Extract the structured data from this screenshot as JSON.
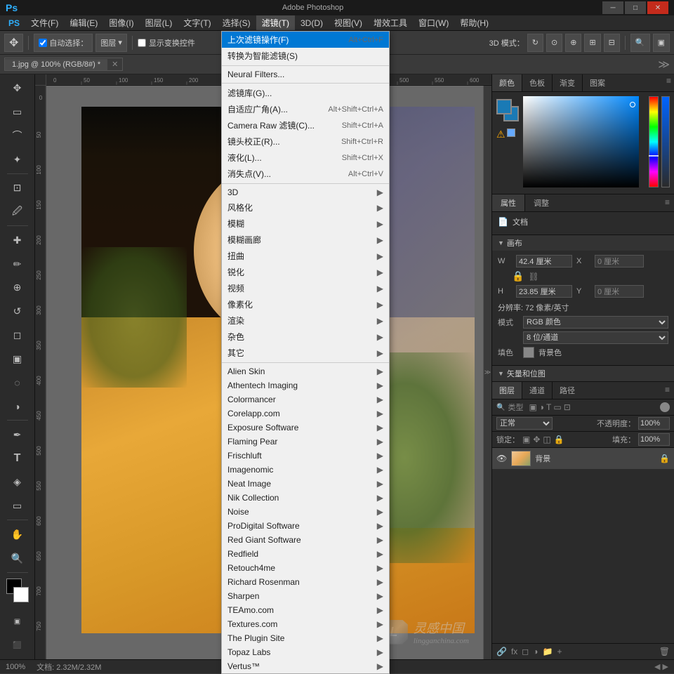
{
  "titleBar": {
    "title": "Adobe Photoshop",
    "fileInfo": "1.jpg @ 100% (RGB/8#) *",
    "controls": [
      "─",
      "□",
      "✕"
    ]
  },
  "menuBar": {
    "items": [
      "PS",
      "文件(F)",
      "编辑(E)",
      "图像(I)",
      "图层(L)",
      "文字(T)",
      "选择(S)",
      "滤镜(T)",
      "3D(D)",
      "视图(V)",
      "增效工具",
      "窗口(W)",
      "帮助(H)"
    ]
  },
  "filterMenu": {
    "active": "滤镜(T)",
    "topItems": [
      {
        "label": "上次滤镜操作(F)",
        "shortcut": "Alt+Ctrl+F",
        "hasArrow": false
      },
      {
        "label": "转换为智能滤镜(S)",
        "hasArrow": false
      }
    ],
    "midItems": [
      {
        "label": "Neural Filters...",
        "hasArrow": false
      }
    ],
    "filterItems": [
      {
        "label": "滤镜库(G)...",
        "hasArrow": false
      },
      {
        "label": "自适应广角(A)...",
        "shortcut": "Alt+Shift+Ctrl+A",
        "hasArrow": false
      },
      {
        "label": "Camera Raw 滤镜(C)...",
        "shortcut": "Shift+Ctrl+A",
        "hasArrow": false
      },
      {
        "label": "镜头校正(R)...",
        "shortcut": "Shift+Ctrl+R",
        "hasArrow": false
      },
      {
        "label": "液化(L)...",
        "shortcut": "Shift+Ctrl+X",
        "hasArrow": false
      },
      {
        "label": "消失点(V)...",
        "shortcut": "Alt+Ctrl+V",
        "hasArrow": false
      }
    ],
    "subMenuItems": [
      {
        "label": "3D",
        "hasArrow": true
      },
      {
        "label": "风格化",
        "hasArrow": true
      },
      {
        "label": "模糊",
        "hasArrow": true
      },
      {
        "label": "模糊画廊",
        "hasArrow": true
      },
      {
        "label": "扭曲",
        "hasArrow": true
      },
      {
        "label": "锐化",
        "hasArrow": true
      },
      {
        "label": "视频",
        "hasArrow": true
      },
      {
        "label": "像素化",
        "hasArrow": true
      },
      {
        "label": "渲染",
        "hasArrow": true
      },
      {
        "label": "杂色",
        "hasArrow": true
      },
      {
        "label": "其它",
        "hasArrow": true
      }
    ],
    "pluginItems": [
      {
        "label": "Alien Skin",
        "hasArrow": true
      },
      {
        "label": "Athentech Imaging",
        "hasArrow": true
      },
      {
        "label": "Colormancer",
        "hasArrow": true
      },
      {
        "label": "Corelapp.com",
        "hasArrow": true
      },
      {
        "label": "Exposure Software",
        "hasArrow": true
      },
      {
        "label": "Flaming Pear",
        "hasArrow": true
      },
      {
        "label": "Frischluft",
        "hasArrow": true
      },
      {
        "label": "Imagenomic",
        "hasArrow": true
      },
      {
        "label": "Neat Image",
        "hasArrow": true
      },
      {
        "label": "Nik Collection",
        "hasArrow": true
      },
      {
        "label": "Noise",
        "hasArrow": true
      },
      {
        "label": "ProDigital Software",
        "hasArrow": true
      },
      {
        "label": "Red Giant Software",
        "hasArrow": true
      },
      {
        "label": "Redfield",
        "hasArrow": true
      },
      {
        "label": "Retouch4me",
        "hasArrow": true
      },
      {
        "label": "Richard Rosenman",
        "hasArrow": true
      },
      {
        "label": "Sharpen",
        "hasArrow": true
      },
      {
        "label": "TEAmo.com",
        "hasArrow": true
      },
      {
        "label": "Textures.com",
        "hasArrow": true
      },
      {
        "label": "The Plugin Site",
        "hasArrow": true
      },
      {
        "label": "Topaz Labs",
        "hasArrow": true
      },
      {
        "label": "Vertus™",
        "hasArrow": true
      }
    ]
  },
  "toolbar": {
    "autoSelect": "自动选择：",
    "layerType": "图层",
    "showTransform": "显示变换控件",
    "mode3D": "3D 模式：",
    "zoomLevel": "100%"
  },
  "rightPanel": {
    "colorTabs": [
      "颜色",
      "色板",
      "渐变",
      "图案"
    ],
    "propTabs": [
      "属性",
      "调整"
    ],
    "docLabel": "文档",
    "canvasSection": {
      "title": "画布",
      "wLabel": "W",
      "hLabel": "H",
      "xLabel": "X",
      "yLabel": "Y",
      "wValue": "42.4 厘米",
      "hValue": "23.85 厘米",
      "xValue": "0 厘米",
      "yValue": "0 厘米",
      "resolution": "分辨率: 72 像素/英寸",
      "modeLabel": "模式",
      "modeValue": "RGB 颜色",
      "depthValue": "8 位/通道",
      "fillLabel": "填色",
      "fillValue": "背景色"
    }
  },
  "layersPanel": {
    "tabs": [
      "图层",
      "通道",
      "路径"
    ],
    "filterPlaceholder": "类型",
    "modeLabel": "正常",
    "opacityLabel": "不透明度：",
    "opacityValue": "100%",
    "lockLabel": "锁定：",
    "fillLabel": "填充：",
    "fillValue": "100%",
    "layers": [
      {
        "name": "背景",
        "locked": true,
        "visible": true
      }
    ]
  },
  "statusBar": {
    "zoom": "100%",
    "docInfo": "文档: 2.32M/2.32M"
  },
  "watermark": {
    "text": "灵感中国",
    "subtext": "lingganchina.com"
  }
}
